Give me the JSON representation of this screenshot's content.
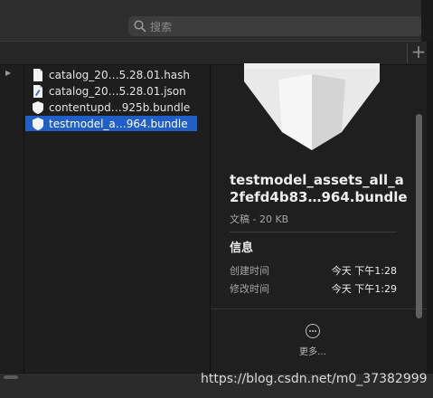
{
  "search": {
    "placeholder": "搜索"
  },
  "files": [
    {
      "name": "catalog_20…5.28.01.hash",
      "icon": "document-icon",
      "selected": false
    },
    {
      "name": "catalog_20…5.28.01.json",
      "icon": "json-document-icon",
      "selected": false
    },
    {
      "name": "contentupd…925b.bundle",
      "icon": "bundle-icon",
      "selected": false
    },
    {
      "name": "testmodel_a…964.bundle",
      "icon": "bundle-icon",
      "selected": true
    }
  ],
  "preview": {
    "title_line1": "testmodel_assets_all_a",
    "title_line2": "2fefd4b83…964.bundle",
    "kind": "文稿 - 20 KB",
    "info_heading": "信息",
    "created_label": "创建时间",
    "created_value": "今天 下午1:28",
    "modified_label": "修改时间",
    "modified_value": "今天 下午1:29",
    "more_label": "更多…"
  },
  "watermark": "https://blog.csdn.net/m0_37382999",
  "colors": {
    "selection": "#1f5fc7",
    "background": "#1e1e1e"
  }
}
